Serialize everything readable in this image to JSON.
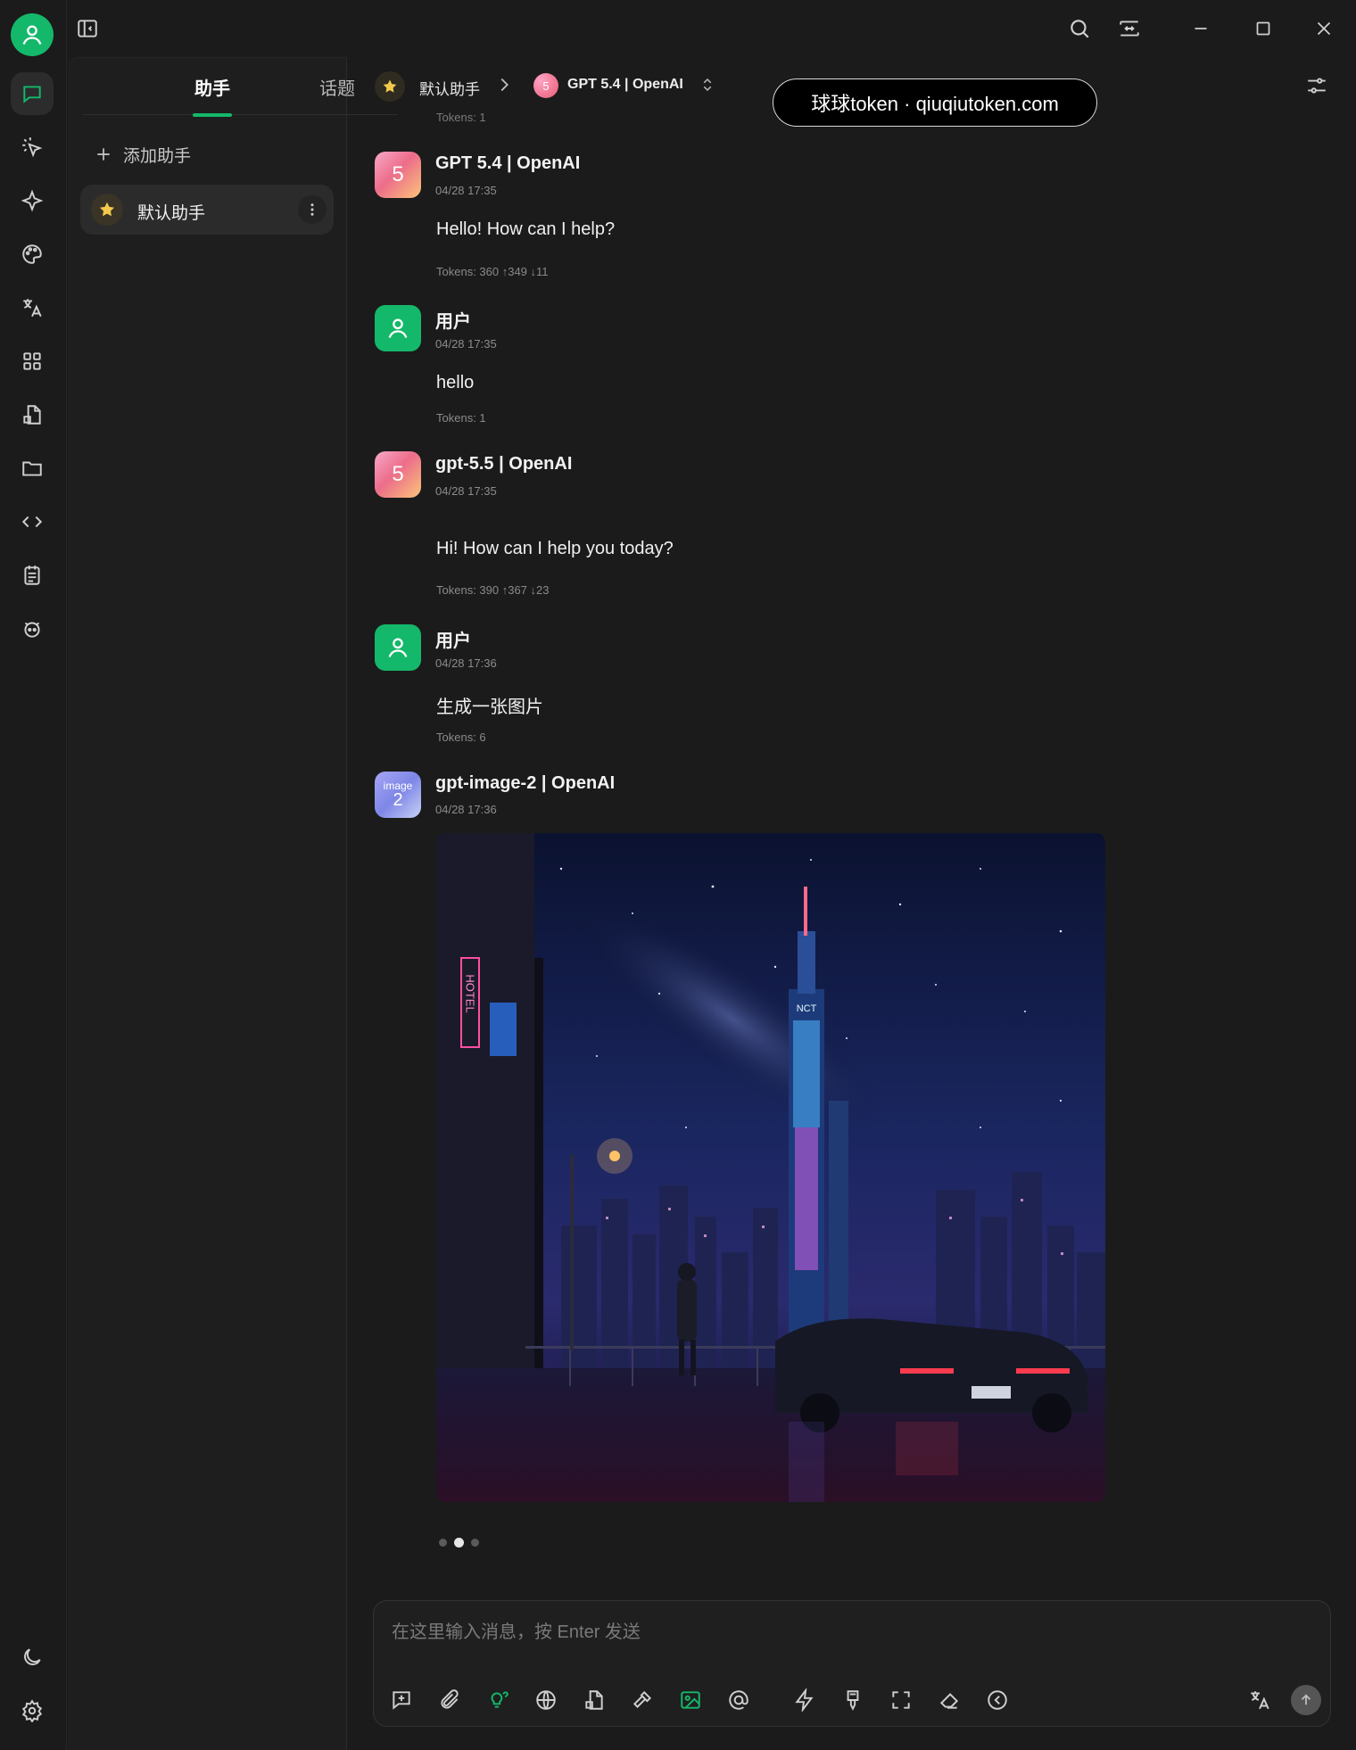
{
  "sidebar_tabs": {
    "assistants": "助手",
    "topics": "话题"
  },
  "add_assistant_label": "添加助手",
  "assistants": [
    {
      "name": "默认助手"
    }
  ],
  "header": {
    "assistant": "默认助手",
    "model": "GPT 5.4 | OpenAI",
    "model_icon_text": "5"
  },
  "watermark": "球球token · qiuqiutoken.com",
  "top_clip_tokens": "Tokens: 1",
  "messages": [
    {
      "role": "assistant",
      "avatar": "5",
      "name": "GPT 5.4 | OpenAI",
      "time": "04/28 17:35",
      "text": "Hello! How can I help?",
      "tokens": "Tokens: 360 ↑349 ↓11"
    },
    {
      "role": "user",
      "name": "用户",
      "time": "04/28 17:35",
      "text": "hello",
      "tokens": "Tokens: 1"
    },
    {
      "role": "assistant",
      "avatar": "5",
      "name": "gpt-5.5 | OpenAI",
      "time": "04/28 17:35",
      "text": "Hi! How can I help you today?",
      "tokens": "Tokens: 390 ↑367 ↓23"
    },
    {
      "role": "user",
      "name": "用户",
      "time": "04/28 17:36",
      "text": "生成一张图片",
      "tokens": "Tokens: 6"
    },
    {
      "role": "assistant",
      "avatar_small": "image",
      "avatar_big": "2",
      "name": "gpt-image-2 | OpenAI",
      "time": "04/28 17:36",
      "image_alt": "generated-cyberpunk-city-image"
    }
  ],
  "image_hotel_sign": "HOTEL",
  "image_tower_sign": "NCT",
  "image_pager": {
    "count": 3,
    "active": 1
  },
  "composer": {
    "placeholder": "在这里输入消息，按 Enter 发送"
  },
  "colors": {
    "accent": "#14b86a",
    "background": "#1b1b1b",
    "panel": "#1e1e1e"
  },
  "icons": [
    "user-avatar-icon",
    "sidebar-toggle-icon",
    "search-icon",
    "minimize-icon",
    "maximize-icon",
    "close-icon",
    "chat-icon",
    "agent-icon",
    "sparkle-icon",
    "palette-icon",
    "translate-icon",
    "apps-icon",
    "files-icon",
    "folder-icon",
    "code-icon",
    "notes-icon",
    "bot-icon",
    "moon-icon",
    "gear-icon"
  ]
}
